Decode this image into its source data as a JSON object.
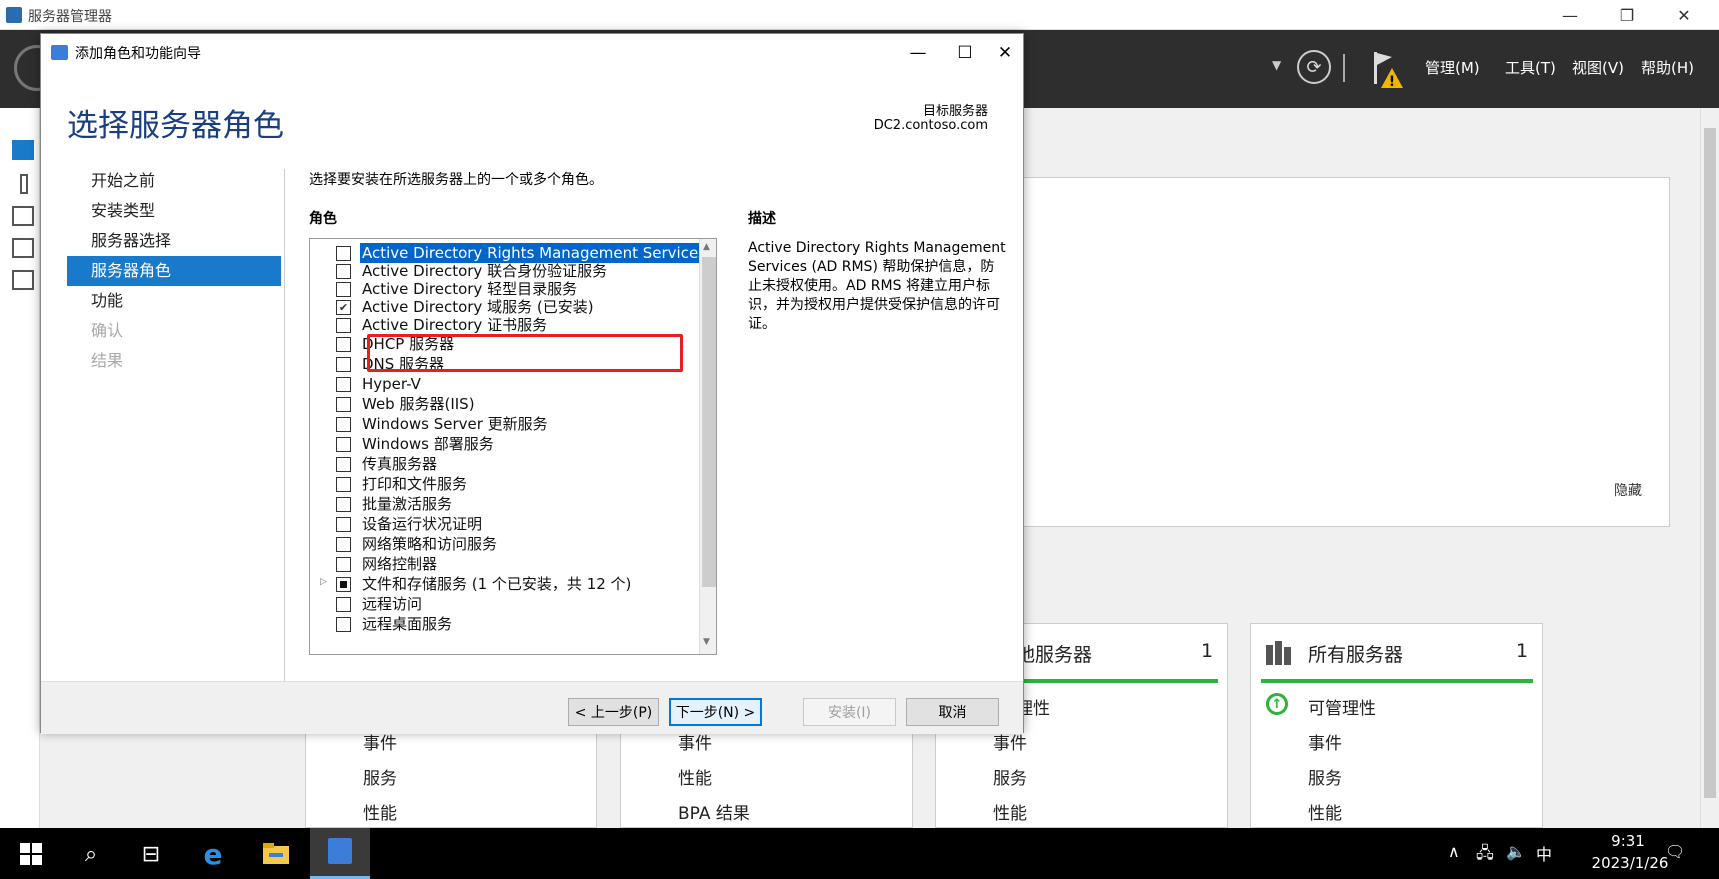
{
  "app": {
    "title": "服务器管理器",
    "menu": [
      "管理(M)",
      "工具(T)",
      "视图(V)",
      "帮助(H)"
    ],
    "hide_label": "隐藏"
  },
  "tiles": [
    {
      "name": "",
      "count": "",
      "rows": [
        "事件",
        "服务",
        "性能"
      ]
    },
    {
      "name": "",
      "count": "",
      "rows": [
        "事件",
        "性能",
        "BPA 结果"
      ]
    },
    {
      "name": "地服务器",
      "count": "1",
      "rows": [
        "理性",
        "事件",
        "服务",
        "性能"
      ]
    },
    {
      "name": "所有服务器",
      "count": "1",
      "rows": [
        "可管理性",
        "事件",
        "服务",
        "性能"
      ]
    }
  ],
  "wizard": {
    "window_title": "添加角色和功能向导",
    "heading": "选择服务器角色",
    "target_label": "目标服务器",
    "target_value": "DC2.contoso.com",
    "nav": [
      {
        "label": "开始之前",
        "state": "normal"
      },
      {
        "label": "安装类型",
        "state": "normal"
      },
      {
        "label": "服务器选择",
        "state": "normal"
      },
      {
        "label": "服务器角色",
        "state": "active"
      },
      {
        "label": "功能",
        "state": "normal"
      },
      {
        "label": "确认",
        "state": "disabled"
      },
      {
        "label": "结果",
        "state": "disabled"
      }
    ],
    "instruction": "选择要安装在所选服务器上的一个或多个角色。",
    "roles_label": "角色",
    "desc_label": "描述",
    "desc_text": "Active Directory Rights Management Services (AD RMS) 帮助保护信息，防止未授权使用。AD RMS 将建立用户标识，并为授权用户提供受保护信息的许可证。",
    "roles": [
      {
        "label": "Active Directory Rights Management Services",
        "checked": "no",
        "selected": true
      },
      {
        "label": "Active Directory 联合身份验证服务",
        "checked": "no"
      },
      {
        "label": "Active Directory 轻型目录服务",
        "checked": "no"
      },
      {
        "label": "Active Directory 域服务 (已安装)",
        "checked": "yes"
      },
      {
        "label": "Active Directory 证书服务",
        "checked": "no"
      },
      {
        "label": "DHCP 服务器",
        "checked": "no"
      },
      {
        "label": "DNS 服务器",
        "checked": "no"
      },
      {
        "label": "Hyper-V",
        "checked": "no"
      },
      {
        "label": "Web 服务器(IIS)",
        "checked": "no"
      },
      {
        "label": "Windows Server 更新服务",
        "checked": "no"
      },
      {
        "label": "Windows 部署服务",
        "checked": "no"
      },
      {
        "label": "传真服务器",
        "checked": "no"
      },
      {
        "label": "打印和文件服务",
        "checked": "no"
      },
      {
        "label": "批量激活服务",
        "checked": "no"
      },
      {
        "label": "设备运行状况证明",
        "checked": "no"
      },
      {
        "label": "网络策略和访问服务",
        "checked": "no"
      },
      {
        "label": "网络控制器",
        "checked": "no"
      },
      {
        "label": "文件和存储服务 (1 个已安装，共 12 个)",
        "checked": "partial",
        "expandable": true
      },
      {
        "label": "远程访问",
        "checked": "no"
      },
      {
        "label": "远程桌面服务",
        "checked": "no"
      }
    ],
    "buttons": {
      "prev": "< 上一步(P)",
      "next": "下一步(N) >",
      "install": "安装(I)",
      "cancel": "取消"
    }
  },
  "taskbar": {
    "time": "9:31",
    "date": "2023/1/26",
    "ime": "中"
  },
  "colors": {
    "accent": "#1979ca",
    "heading": "#1a3f80",
    "highlight_box": "#e62020",
    "status_green": "#2cb33b"
  }
}
